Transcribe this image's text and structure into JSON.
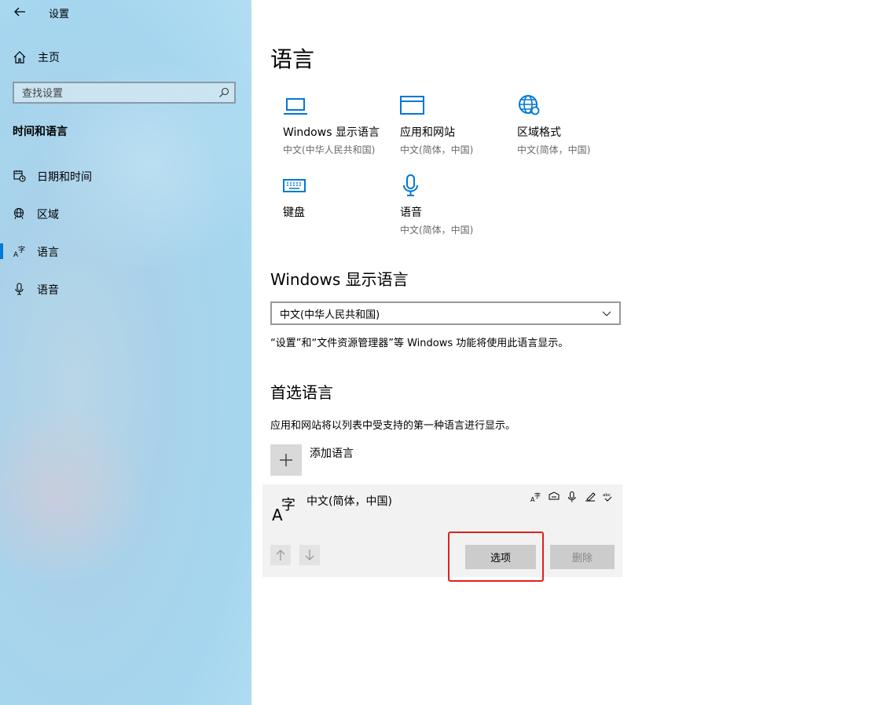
{
  "window": {
    "title": "设置"
  },
  "sidebar": {
    "home_label": "主页",
    "search_placeholder": "查找设置",
    "section_title": "时间和语言",
    "items": [
      {
        "label": "日期和时间",
        "icon": "calendar-clock-icon",
        "selected": false
      },
      {
        "label": "区域",
        "icon": "globe-icon",
        "selected": false
      },
      {
        "label": "语言",
        "icon": "language-icon",
        "selected": true
      },
      {
        "label": "语音",
        "icon": "microphone-icon",
        "selected": false
      }
    ]
  },
  "main": {
    "title": "语言",
    "tiles": [
      {
        "name": "Windows 显示语言",
        "sub": "中文(中华人民共和国)",
        "icon": "laptop-icon"
      },
      {
        "name": "应用和网站",
        "sub": "中文(简体，中国)",
        "icon": "browser-window-icon"
      },
      {
        "name": "区域格式",
        "sub": "中文(简体，中国)",
        "icon": "globe-settings-icon"
      },
      {
        "name": "键盘",
        "sub": "",
        "icon": "keyboard-icon"
      },
      {
        "name": "语音",
        "sub": "中文(简体，中国)",
        "icon": "microphone-icon"
      }
    ],
    "display_language": {
      "heading": "Windows 显示语言",
      "selected": "中文(中华人民共和国)",
      "note": "“设置”和“文件资源管理器”等 Windows 功能将使用此语言显示。"
    },
    "preferred": {
      "heading": "首选语言",
      "description": "应用和网站将以列表中受支持的第一种语言进行显示。",
      "add_label": "添加语言",
      "languages": [
        {
          "name": "中文(简体，中国)",
          "feature_icons": [
            "display-language-icon",
            "speech-bubble-icon",
            "microphone-icon",
            "handwriting-icon",
            "spellcheck-icon"
          ],
          "options_label": "选项",
          "remove_label": "删除"
        }
      ]
    }
  },
  "colors": {
    "accent": "#0078d7",
    "highlight": "#e02020"
  }
}
